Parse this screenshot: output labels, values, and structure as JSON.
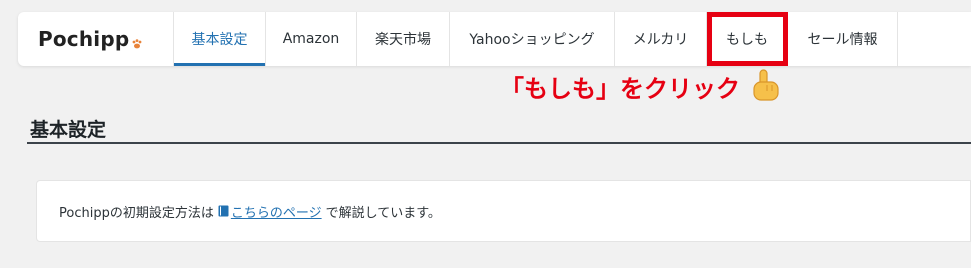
{
  "logo": {
    "text": "Pochipp",
    "icon": "paw-icon"
  },
  "tabs": [
    {
      "label": "基本設定",
      "active": true,
      "highlighted": false
    },
    {
      "label": "Amazon",
      "active": false,
      "highlighted": false
    },
    {
      "label": "楽天市場",
      "active": false,
      "highlighted": false
    },
    {
      "label": "Yahooショッピング",
      "active": false,
      "highlighted": false
    },
    {
      "label": "メルカリ",
      "active": false,
      "highlighted": false
    },
    {
      "label": "もしも",
      "active": false,
      "highlighted": true
    },
    {
      "label": "セール情報",
      "active": false,
      "highlighted": false
    }
  ],
  "annotation": {
    "text": "「もしも」をクリック",
    "icon": "pointing-hand-icon",
    "color": "#e60012"
  },
  "section": {
    "title": "基本設定"
  },
  "notice": {
    "prefix": "Pochippの初期設定方法は",
    "link_text": "こちらのページ",
    "link_icon": "book-icon",
    "suffix": "で解説しています。"
  },
  "colors": {
    "accent": "#2271b1",
    "highlight": "#e60012"
  }
}
